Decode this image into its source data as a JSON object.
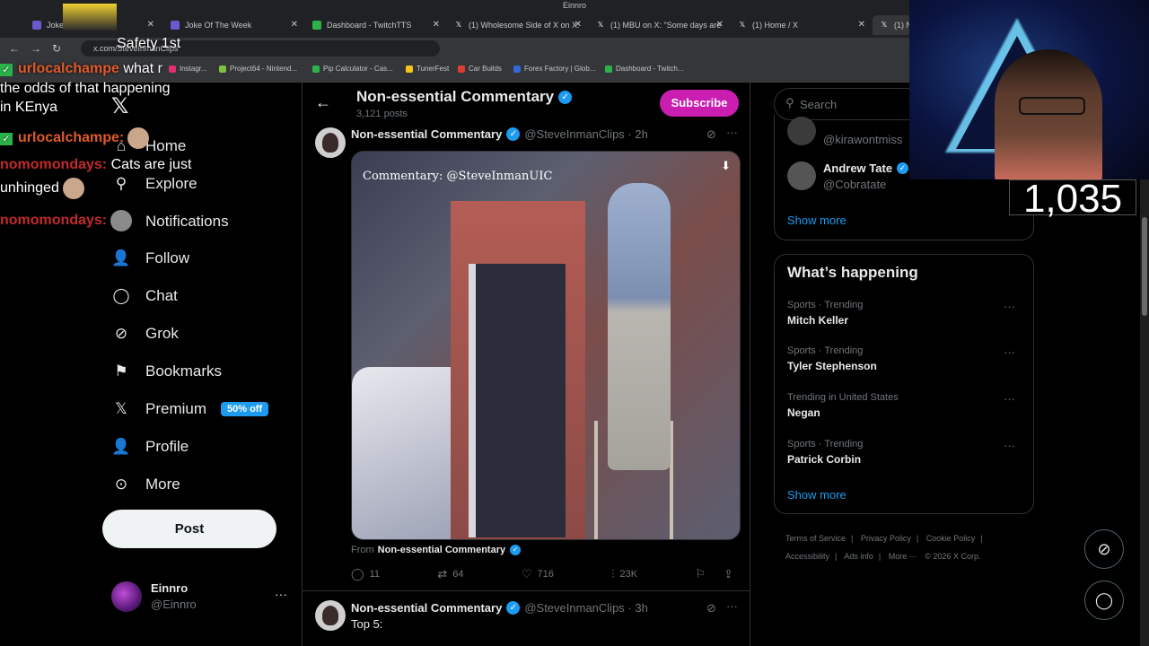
{
  "window": {
    "title": "Einnro"
  },
  "tabs": [
    {
      "label": "Joke Of The Week",
      "color": "#6a5acd",
      "active": false
    },
    {
      "label": "Joke Of The Week",
      "color": "#6a5acd",
      "active": false
    },
    {
      "label": "Dashboard - TwitchTTS",
      "color": "#2bb34a",
      "active": false
    },
    {
      "label": "(1) Wholesome Side of X on X:",
      "color": "#ffffff",
      "active": false
    },
    {
      "label": "(1) MBU on X: \"Some days are",
      "color": "#ffffff",
      "active": false
    },
    {
      "label": "(1) Home / X",
      "color": "#ffffff",
      "active": false
    },
    {
      "label": "(1) N",
      "color": "#ffffff",
      "active": true
    }
  ],
  "address": {
    "url": "x.com/SteveInmanClips"
  },
  "bookmarks": [
    {
      "label": "Instagr...",
      "color": "#e1306c"
    },
    {
      "label": "Project64 - Nintend...",
      "color": "#7cc142"
    },
    {
      "label": "Pip Calculator - Cas...",
      "color": "#2bb34a"
    },
    {
      "label": "TunerFest",
      "color": "#f5c518"
    },
    {
      "label": "Car Builds",
      "color": "#e03c31"
    },
    {
      "label": "Forex Factory | Glob...",
      "color": "#3367d6"
    },
    {
      "label": "Dashboard - Twitch...",
      "color": "#2bb34a"
    }
  ],
  "nav": {
    "items": [
      {
        "label": "Home",
        "icon": "home-icon",
        "glyph": "⌂"
      },
      {
        "label": "Explore",
        "icon": "search-icon",
        "glyph": "⚲"
      },
      {
        "label": "Notifications",
        "icon": "bell-icon",
        "glyph": "🔔"
      },
      {
        "label": "Follow",
        "icon": "add-person-icon",
        "glyph": "👤"
      },
      {
        "label": "Chat",
        "icon": "chat-icon",
        "glyph": "◯"
      },
      {
        "label": "Grok",
        "icon": "grok-icon",
        "glyph": "⊘"
      },
      {
        "label": "Bookmarks",
        "icon": "bookmark-icon",
        "glyph": "⚑"
      },
      {
        "label": "Premium",
        "icon": "x-icon",
        "glyph": "𝕏"
      },
      {
        "label": "Profile",
        "icon": "person-icon",
        "glyph": "👤"
      },
      {
        "label": "More",
        "icon": "more-circle-icon",
        "glyph": "⊙"
      }
    ],
    "premium_badge": "50% off",
    "post_label": "Post",
    "logo": "𝕏"
  },
  "account": {
    "name": "Einnro",
    "handle": "@Einnro"
  },
  "profile_header": {
    "name": "Non-essential Commentary",
    "post_count": "3,121 posts",
    "subscribe_label": "Subscribe"
  },
  "tweets": [
    {
      "name": "Non-essential Commentary",
      "handle": "@SteveInmanClips · 2h",
      "media_caption": "Commentary: @SteveInmanUIC",
      "from_prefix": "From",
      "from_name": "Non-essential Commentary",
      "replies": "11",
      "reposts": "64",
      "likes": "716",
      "views": "23K"
    },
    {
      "name": "Non-essential Commentary",
      "handle": "@SteveInmanClips · 3h",
      "text": "Top 5:"
    }
  ],
  "right": {
    "search_placeholder": "Search",
    "who_to_follow": [
      {
        "name": "",
        "handle": "@kirawontmiss"
      },
      {
        "name": "Andrew Tate",
        "handle": "@Cobratate"
      }
    ],
    "who_show_more": "Show more",
    "happening_title": "What’s happening",
    "trends": [
      {
        "meta": "Sports · Trending",
        "name": "Mitch Keller"
      },
      {
        "meta": "Sports · Trending",
        "name": "Tyler Stephenson"
      },
      {
        "meta": "Trending in United States",
        "name": "Negan"
      },
      {
        "meta": "Sports · Trending",
        "name": "Patrick Corbin"
      }
    ],
    "trends_show_more": "Show more",
    "footer": [
      "Terms of Service",
      "|",
      "Privacy Policy",
      "|",
      "Cookie Policy",
      "|",
      "Accessibility",
      "|",
      "Ads info",
      "|",
      "More ···",
      "© 2026 X Corp."
    ]
  },
  "overlay": {
    "counter": "1,035",
    "chat": [
      {
        "user": "",
        "text": "Safety 1st",
        "check": false
      },
      {
        "user": "urlocalchampe",
        "text": "what r",
        "check": true
      },
      {
        "user": "",
        "text": "the odds of that happening",
        "check": false
      },
      {
        "user": "",
        "text": "in KEnya",
        "check": false
      },
      {
        "user": "urlocalchampe:",
        "text": "",
        "check": true
      },
      {
        "user": "nomomondays:",
        "text": "Cats are just",
        "check": false
      },
      {
        "user": "",
        "text": "unhinged",
        "check": false
      },
      {
        "user": "nomomondays:",
        "text": "",
        "check": false
      }
    ]
  },
  "colors": {
    "accent": "#1d9bf0",
    "subscribe": "#c91eb0",
    "background": "#000000"
  }
}
